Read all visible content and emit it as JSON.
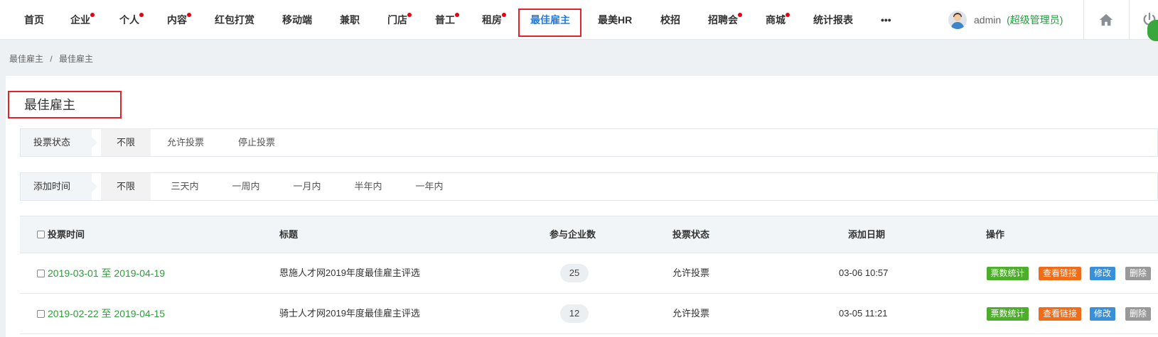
{
  "nav": {
    "items": [
      {
        "label": "首页",
        "dot": false
      },
      {
        "label": "企业",
        "dot": true
      },
      {
        "label": "个人",
        "dot": true
      },
      {
        "label": "内容",
        "dot": true
      },
      {
        "label": "红包打赏",
        "dot": false
      },
      {
        "label": "移动端",
        "dot": false
      },
      {
        "label": "兼职",
        "dot": false
      },
      {
        "label": "门店",
        "dot": true
      },
      {
        "label": "普工",
        "dot": true
      },
      {
        "label": "租房",
        "dot": true
      },
      {
        "label": "最佳雇主",
        "dot": false,
        "active": true
      },
      {
        "label": "最美HR",
        "dot": false
      },
      {
        "label": "校招",
        "dot": false
      },
      {
        "label": "招聘会",
        "dot": true
      },
      {
        "label": "商城",
        "dot": true
      },
      {
        "label": "统计报表",
        "dot": false
      },
      {
        "label": "•••",
        "dot": false
      }
    ],
    "username": "admin",
    "role": "(超级管理员)",
    "home_icon": "home-icon",
    "power_icon": "power-icon",
    "accent_color": "#2b7bd6",
    "dot_color": "#e60012"
  },
  "breadcrumb": {
    "root": "最佳雇主",
    "separator": "/",
    "current": "最佳雇主"
  },
  "page": {
    "title": "最佳雇主"
  },
  "filters": {
    "vote_status": {
      "label": "投票状态",
      "options": [
        "不限",
        "允许投票",
        "停止投票"
      ],
      "selected": "不限"
    },
    "add_time": {
      "label": "添加时间",
      "options": [
        "不限",
        "三天内",
        "一周内",
        "一月内",
        "半年内",
        "一年内"
      ],
      "selected": "不限"
    }
  },
  "table": {
    "headers": {
      "vote_time": "投票时间",
      "title": "标题",
      "companies": "参与企业数",
      "status": "投票状态",
      "added": "添加日期",
      "actions": "操作"
    },
    "action_labels": {
      "stat": "票数统计",
      "link": "查看链接",
      "edit": "修改",
      "delete": "删除"
    },
    "rows": [
      {
        "start": "2019-03-01",
        "to": "至",
        "end": "2019-04-19",
        "title": "恩施人才网2019年度最佳雇主评选",
        "companies": "25",
        "status": "允许投票",
        "added": "03-06 10:57"
      },
      {
        "start": "2019-02-22",
        "to": "至",
        "end": "2019-04-15",
        "title": "骑士人才网2019年度最佳雇主评选",
        "companies": "12",
        "status": "允许投票",
        "added": "03-05 11:21"
      }
    ]
  },
  "colors": {
    "highlight_border": "#e0242b",
    "date_green": "#2c9e3a",
    "btn_stat": "#4cae2b",
    "btn_link": "#f26b16",
    "btn_edit": "#3a8fd9",
    "btn_delete": "#999999"
  }
}
